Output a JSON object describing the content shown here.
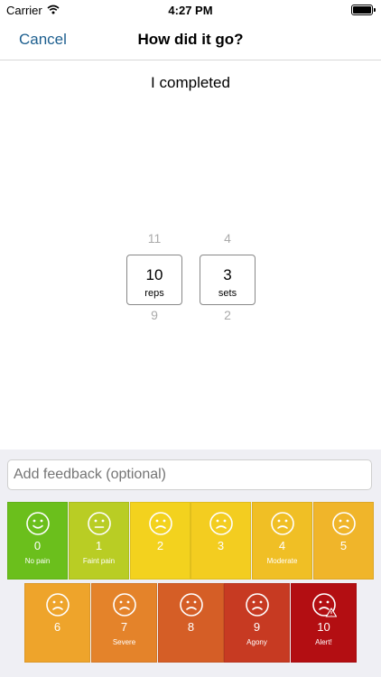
{
  "status": {
    "carrier": "Carrier",
    "time": "4:27 PM"
  },
  "nav": {
    "cancel": "Cancel",
    "title": "How did it go?"
  },
  "headline": "I completed",
  "pickers": [
    {
      "above": "11",
      "value": "10",
      "unit": "reps",
      "below": "9"
    },
    {
      "above": "4",
      "value": "3",
      "unit": "sets",
      "below": "2"
    }
  ],
  "feedback": {
    "placeholder": "Add feedback (optional)"
  },
  "pain_scale": [
    {
      "value": "0",
      "caption": "No pain",
      "face": "smile",
      "color": "#6bbf1c"
    },
    {
      "value": "1",
      "caption": "Faint pain",
      "face": "neutral",
      "color": "#b9cd24"
    },
    {
      "value": "2",
      "caption": "",
      "face": "frown",
      "color": "#f3d21e"
    },
    {
      "value": "3",
      "caption": "",
      "face": "frown",
      "color": "#f3cd20"
    },
    {
      "value": "4",
      "caption": "Moderate",
      "face": "frown",
      "color": "#f0bf25"
    },
    {
      "value": "5",
      "caption": "",
      "face": "frown",
      "color": "#f0b52a"
    },
    {
      "value": "6",
      "caption": "",
      "face": "frown",
      "color": "#eea42b"
    },
    {
      "value": "7",
      "caption": "Severe",
      "face": "frown",
      "color": "#e4832a"
    },
    {
      "value": "8",
      "caption": "",
      "face": "frown",
      "color": "#d55e26"
    },
    {
      "value": "9",
      "caption": "Agony",
      "face": "frown",
      "color": "#c73a22"
    },
    {
      "value": "10",
      "caption": "Alert!",
      "face": "frown-alert",
      "color": "#b30e12"
    }
  ]
}
